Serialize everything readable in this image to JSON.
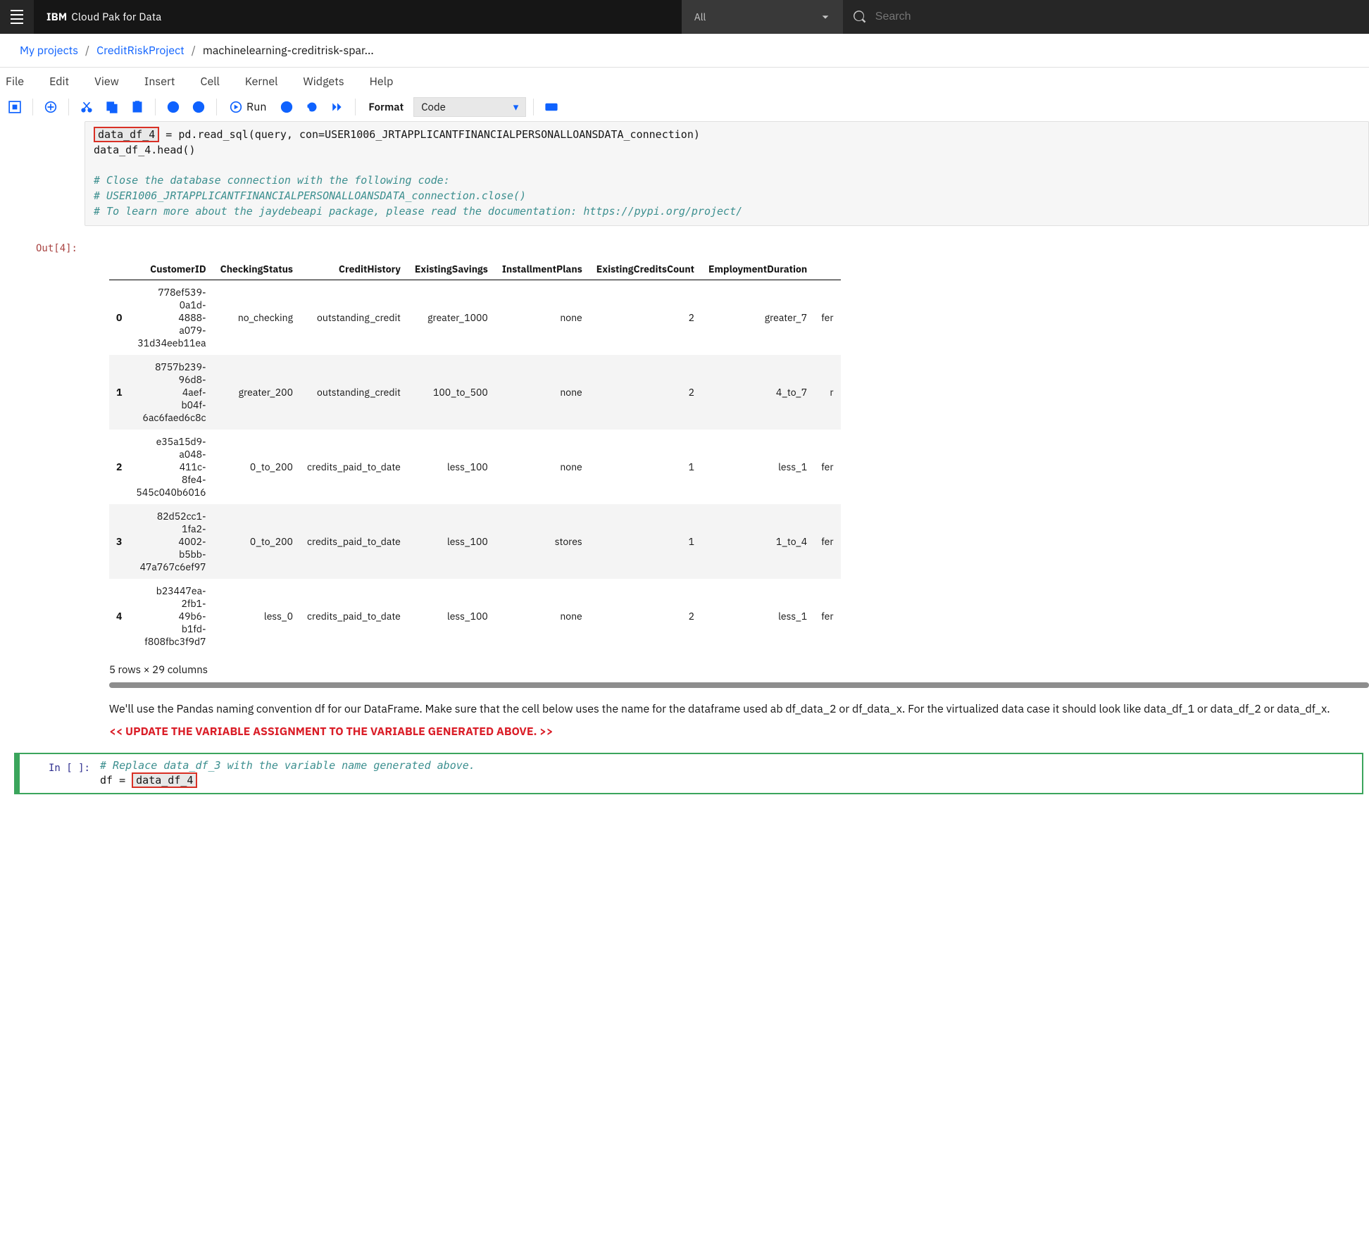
{
  "header": {
    "brand_ibm": "IBM",
    "brand_rest": "Cloud Pak for Data",
    "all_label": "All",
    "search_placeholder": "Search"
  },
  "breadcrumb": {
    "root": "My projects",
    "project": "CreditRiskProject",
    "file": "machinelearning-creditrisk-spar..."
  },
  "jupyter_menu": [
    "File",
    "Edit",
    "View",
    "Insert",
    "Cell",
    "Kernel",
    "Widgets",
    "Help"
  ],
  "toolbar": {
    "run_label": "Run",
    "format_label": "Format",
    "format_value": "Code"
  },
  "code_top": {
    "var_highlight": "data_df_4",
    "assign_rest": " = pd.read_sql(query, con=USER1006_JRTAPPLICANTFINANCIALPERSONALLOANSDATA_connection)",
    "line2": "data_df_4.head()",
    "cmt1": "# Close the database connection with the following code:",
    "cmt2": "# USER1006_JRTAPPLICANTFINANCIALPERSONALLOANSDATA_connection.close()",
    "cmt3": "# To learn more about the jaydebeapi package, please read the documentation: https://pypi.org/project/"
  },
  "out_label": "Out[4]:",
  "df": {
    "columns": [
      "CustomerID",
      "CheckingStatus",
      "CreditHistory",
      "ExistingSavings",
      "InstallmentPlans",
      "ExistingCreditsCount",
      "EmploymentDuration",
      ""
    ],
    "rows": [
      {
        "idx": "0",
        "CustomerID": "778ef539-0a1d-4888-a079-31d34eeb11ea",
        "CheckingStatus": "no_checking",
        "CreditHistory": "outstanding_credit",
        "ExistingSavings": "greater_1000",
        "InstallmentPlans": "none",
        "ExistingCreditsCount": "2",
        "EmploymentDuration": "greater_7",
        "x": "fer"
      },
      {
        "idx": "1",
        "CustomerID": "8757b239-96d8-4aef-b04f-6ac6faed6c8c",
        "CheckingStatus": "greater_200",
        "CreditHistory": "outstanding_credit",
        "ExistingSavings": "100_to_500",
        "InstallmentPlans": "none",
        "ExistingCreditsCount": "2",
        "EmploymentDuration": "4_to_7",
        "x": "r"
      },
      {
        "idx": "2",
        "CustomerID": "e35a15d9-a048-411c-8fe4-545c040b6016",
        "CheckingStatus": "0_to_200",
        "CreditHistory": "credits_paid_to_date",
        "ExistingSavings": "less_100",
        "InstallmentPlans": "none",
        "ExistingCreditsCount": "1",
        "EmploymentDuration": "less_1",
        "x": "fer"
      },
      {
        "idx": "3",
        "CustomerID": "82d52cc1-1fa2-4002-b5bb-47a767c6ef97",
        "CheckingStatus": "0_to_200",
        "CreditHistory": "credits_paid_to_date",
        "ExistingSavings": "less_100",
        "InstallmentPlans": "stores",
        "ExistingCreditsCount": "1",
        "EmploymentDuration": "1_to_4",
        "x": "fer"
      },
      {
        "idx": "4",
        "CustomerID": "b23447ea-2fb1-49b6-b1fd-f808fbc3f9d7",
        "CheckingStatus": "less_0",
        "CreditHistory": "credits_paid_to_date",
        "ExistingSavings": "less_100",
        "InstallmentPlans": "none",
        "ExistingCreditsCount": "2",
        "EmploymentDuration": "less_1",
        "x": "fer"
      }
    ],
    "footer": "5 rows × 29 columns"
  },
  "md": {
    "p1": "We'll use the Pandas naming convention df for our DataFrame. Make sure that the cell below uses the name for the dataframe used ab  df_data_2 or df_data_x. For the virtualized data case it should look like data_df_1 or data_df_2 or data_df_x.",
    "alert": "<< UPDATE THE VARIABLE ASSIGNMENT TO THE VARIABLE GENERATED ABOVE. >>"
  },
  "in_label": "In [ ]:",
  "code_bottom": {
    "cmt": "# Replace data_df_3 with the variable name generated above.",
    "assign_pre": "df = ",
    "assign_hl": "data_df_4"
  }
}
